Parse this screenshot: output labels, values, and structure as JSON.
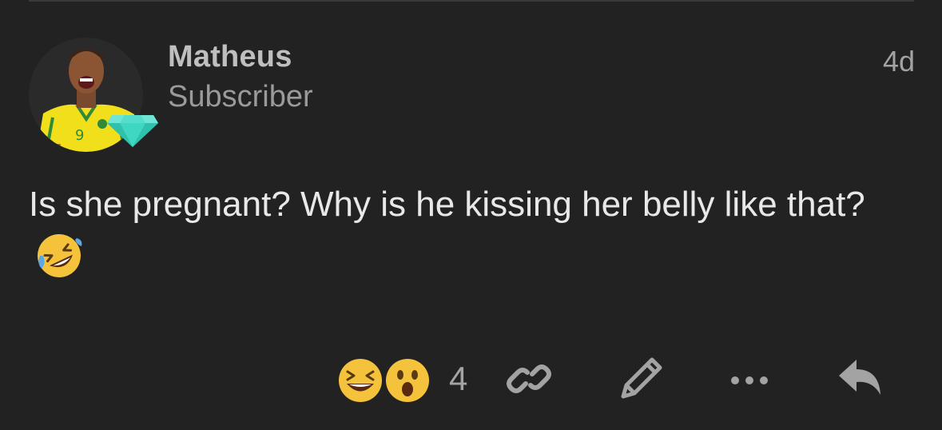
{
  "post": {
    "username": "Matheus",
    "user_title": "Subscriber",
    "timestamp": "4d",
    "text": "Is she pregnant? Why is he kissing her belly like that?",
    "inline_emoji": "rolling-on-the-floor-laughing"
  },
  "reactions": {
    "items": [
      "laughing-face",
      "surprised-face"
    ],
    "count": "4"
  },
  "actions": [
    "copy-link",
    "edit",
    "more-options",
    "reply"
  ],
  "colors": {
    "background": "#222222",
    "badge": "#3fd6c2",
    "emoji": "#f5c33b",
    "icon": "#a3a3a3"
  }
}
